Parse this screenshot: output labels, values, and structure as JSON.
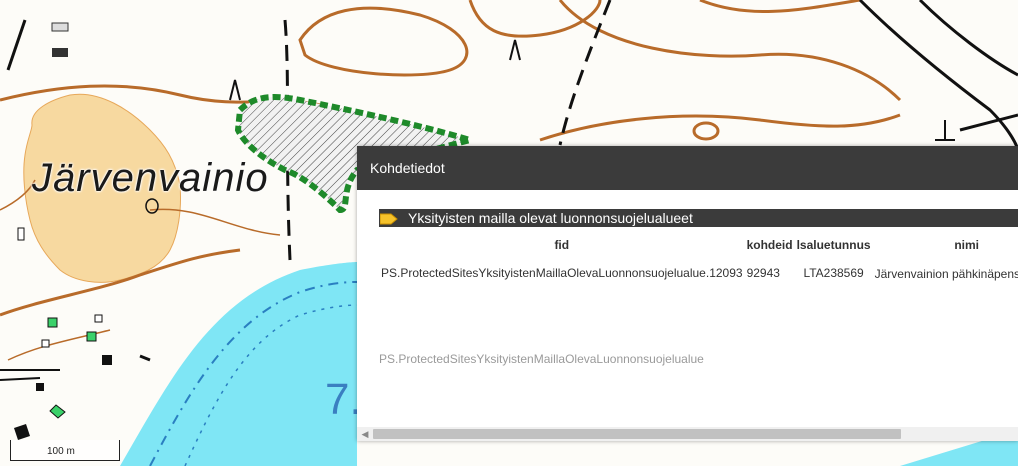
{
  "map": {
    "place_label": "Järvenvainio",
    "lake_number": "7.",
    "scale_label": "100 m"
  },
  "popup": {
    "title": "Kohdetiedot",
    "layer_title": "Yksityisten mailla olevat luonnonsuojelualueet",
    "layer_icon": "folder-icon",
    "columns": [
      "fid",
      "kohdeid",
      "lsaluetunnus",
      "nimi"
    ],
    "rows": [
      {
        "fid": "PS.ProtectedSitesYksityistenMaillaOlevaLuonnonsuojelualue.12093",
        "kohdeid": "92943",
        "lsaluetunnus": "LTA238569",
        "nimi": "Järvenvainion pähkinäpensaslehto"
      }
    ],
    "layer_name": "PS.ProtectedSitesYksityistenMaillaOlevaLuonnonsuojelualue",
    "scroll_arrow": "◀"
  },
  "colors": {
    "header_bg": "#3b3b3b",
    "field": "#f7d9a0",
    "water": "#7fe6f5",
    "contour": "#b86b2a",
    "protected_area": "#1e8a2a"
  }
}
